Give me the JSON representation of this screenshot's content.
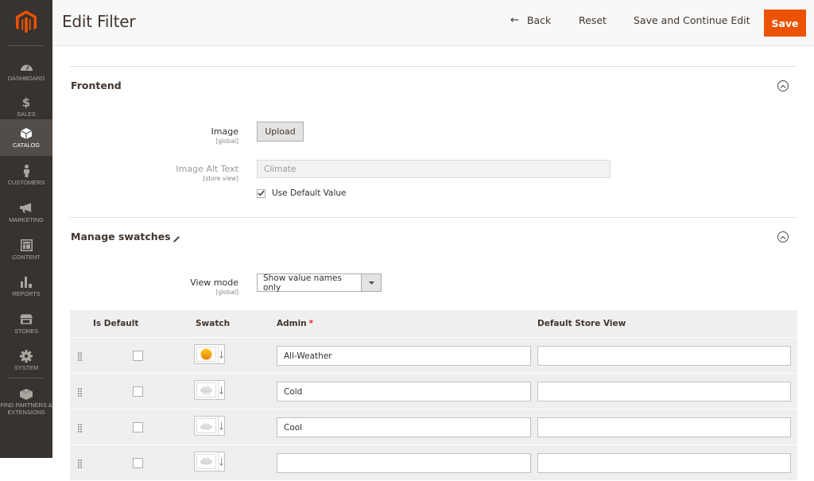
{
  "sidebar": {
    "logo": "magento-logo",
    "items": [
      {
        "label": "Dashboard",
        "icon": "dashboard-icon",
        "active": false
      },
      {
        "label": "Sales",
        "icon": "dollar-icon",
        "active": false
      },
      {
        "label": "Catalog",
        "icon": "box-icon",
        "active": true
      },
      {
        "label": "Customers",
        "icon": "person-icon",
        "active": false
      },
      {
        "label": "Marketing",
        "icon": "megaphone-icon",
        "active": false
      },
      {
        "label": "Content",
        "icon": "layout-icon",
        "active": false
      },
      {
        "label": "Reports",
        "icon": "bar-chart-icon",
        "active": false
      },
      {
        "label": "Stores",
        "icon": "storefront-icon",
        "active": false
      },
      {
        "label": "System",
        "icon": "gear-icon",
        "active": false
      },
      {
        "label": "Find Partners & Extensions",
        "icon": "lego-brick-icon",
        "active": false
      }
    ]
  },
  "header": {
    "title": "Edit Filter",
    "back_label": "Back",
    "reset_label": "Reset",
    "save_continue_label": "Save and Continue Edit",
    "save_label": "Save",
    "accent_color": "#eb5202"
  },
  "frontend": {
    "title": "Frontend",
    "image_label": "Image",
    "image_scope": "[global]",
    "upload_label": "Upload",
    "alt_label": "Image Alt Text",
    "alt_scope": "[store view]",
    "alt_value": "Climate",
    "use_default_label": "Use Default Value",
    "use_default_checked": true
  },
  "swatches": {
    "title": "Manage swatches",
    "view_mode_label": "View mode",
    "view_mode_scope": "[global]",
    "view_mode_value": "Show value names only",
    "columns": {
      "is_default": "Is Default",
      "swatch": "Swatch",
      "admin": "Admin",
      "admin_required": "*",
      "store_view": "Default Store View"
    },
    "rows": [
      {
        "swatch": "sun-icon",
        "admin": "All-Weather",
        "store_view": "",
        "is_default": false
      },
      {
        "swatch": "snow-cloud-icon",
        "admin": "Cold",
        "store_view": "",
        "is_default": false
      },
      {
        "swatch": "cloud-icon",
        "admin": "Cool",
        "store_view": "",
        "is_default": false
      },
      {
        "swatch": "snow-cloud-icon",
        "admin": "",
        "store_view": "",
        "is_default": false
      }
    ]
  }
}
